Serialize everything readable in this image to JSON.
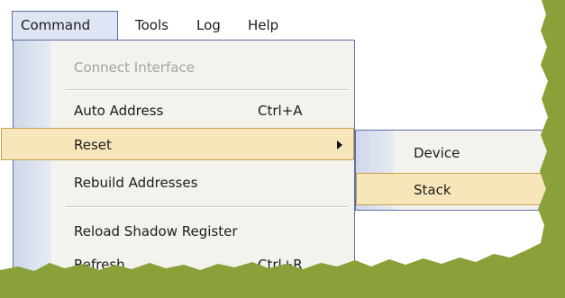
{
  "menubar": {
    "items": [
      {
        "label": "Command",
        "active": true
      },
      {
        "label": "Tools"
      },
      {
        "label": "Log"
      },
      {
        "label": "Help"
      }
    ]
  },
  "command_menu": {
    "items": [
      {
        "label": "Connect Interface",
        "enabled": false
      },
      {
        "label": "Auto Address",
        "shortcut": "Ctrl+A"
      },
      {
        "label": "Reset",
        "has_submenu": true,
        "highlighted": true
      },
      {
        "label": "Rebuild Addresses"
      },
      {
        "label": "Reload Shadow Register"
      },
      {
        "label": "Refresh",
        "shortcut": "Ctrl+R"
      }
    ]
  },
  "reset_submenu": {
    "items": [
      {
        "label": "Device"
      },
      {
        "label": "Stack",
        "highlighted": true
      }
    ]
  },
  "colors": {
    "highlight": "#f6e6ba",
    "menu_border": "#5e6fa4",
    "torn_edge": "#8aa038"
  }
}
